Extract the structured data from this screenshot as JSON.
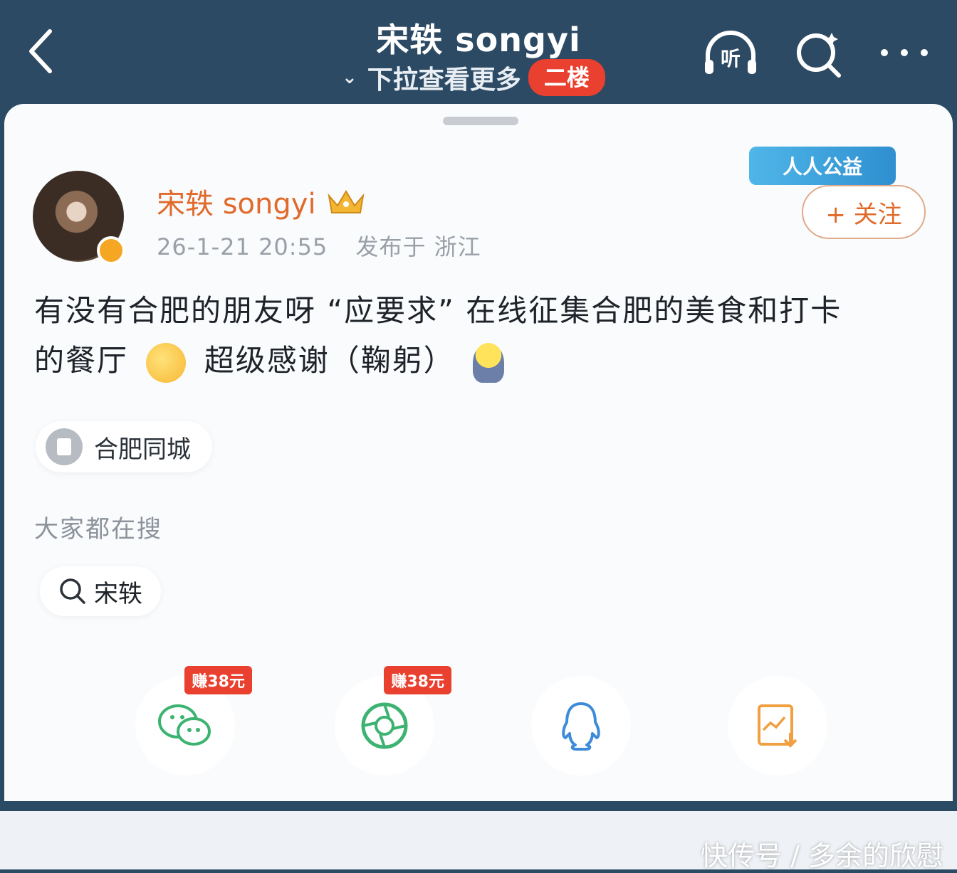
{
  "header": {
    "title": "宋轶 songyi",
    "subtitle": "下拉查看更多",
    "floor_badge": "二楼",
    "listen_label": "听"
  },
  "post": {
    "author": "宋轶 songyi",
    "date": "26-1-21 20:55",
    "location": "发布于 浙江",
    "charity_badge": "人人公益",
    "follow_label": "+ 关注",
    "text_line1": "有没有合肥的朋友呀 “应要求” 在线征集合肥的美食和打卡",
    "text_line2a": "的餐厅",
    "text_line2b": "超级感谢（鞠躬）",
    "topic": "合肥同城",
    "search_section": "大家都在搜",
    "search_term": "宋轶"
  },
  "share": {
    "wechat_earn": "赚38元",
    "moments_earn": "赚38元"
  },
  "footer": {
    "watermark": "快传号 / 多余的欣慰"
  },
  "colors": {
    "header_bg": "#2c4a63",
    "accent_orange": "#e06a2a",
    "badge_red": "#e9402f",
    "wechat_green": "#3cb371",
    "qq_blue": "#3d8bd9",
    "save_orange": "#f0a040"
  }
}
